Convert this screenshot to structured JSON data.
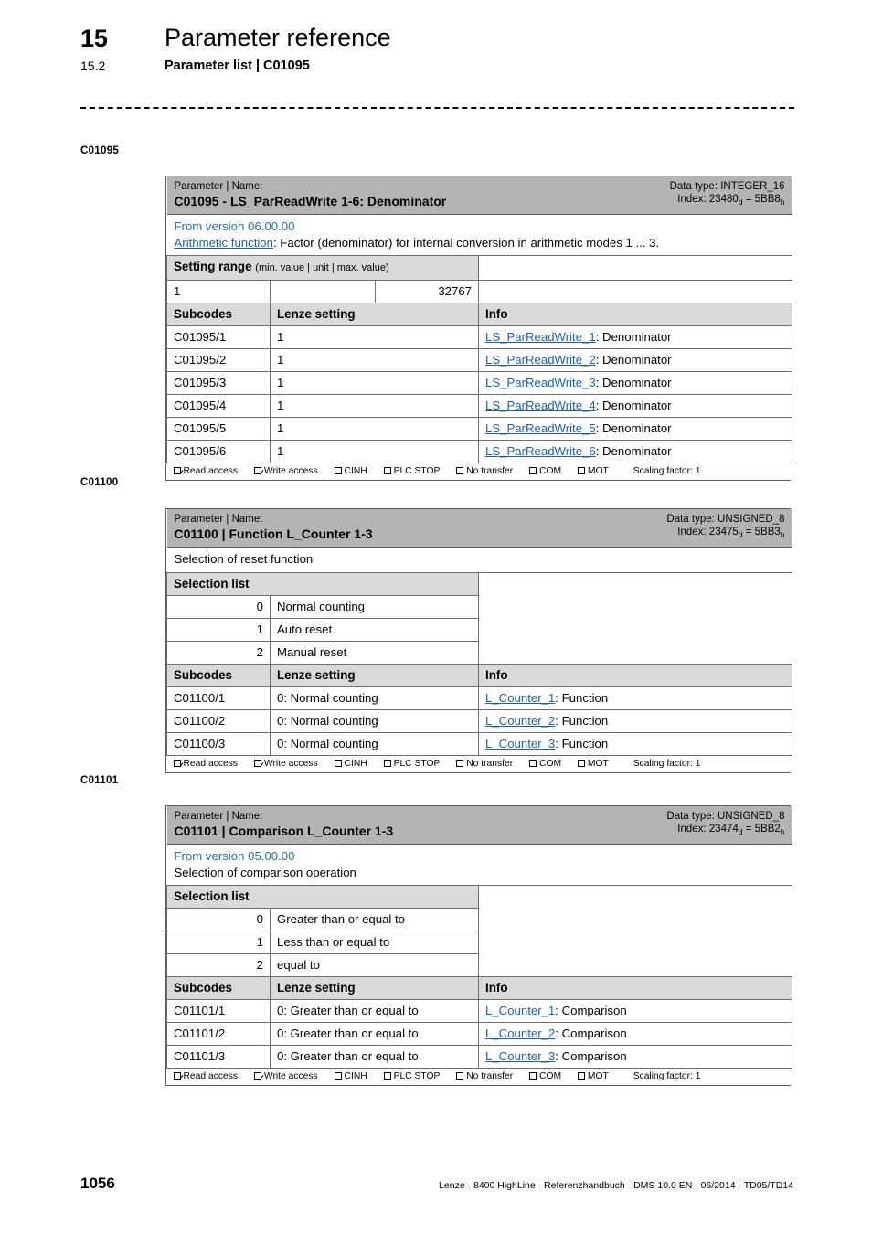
{
  "header": {
    "chapter_number": "15",
    "chapter_title": "Parameter reference",
    "section_number": "15.2",
    "section_title": "Parameter list | C01095"
  },
  "footer": {
    "page_number": "1056",
    "credit": "Lenze · 8400 HighLine · Referenzhandbuch · DMS 10.0 EN · 06/2014 · TD05/TD14"
  },
  "common": {
    "param_name_label": "Parameter | Name:",
    "subcodes_header": "Subcodes",
    "lenze_setting_header": "Lenze setting",
    "info_header": "Info",
    "selection_list_header": "Selection list",
    "access": {
      "read": "Read access",
      "write": "Write access",
      "cinh": "CINH",
      "plc_stop": "PLC STOP",
      "no_transfer": "No transfer",
      "com": "COM",
      "mot": "MOT",
      "scaling": "Scaling factor: 1"
    },
    "link_color": "#1f5fa9",
    "version_color": "#2b6ca3",
    "title_band_color": "#b4b4b4",
    "subheader_color": "#d9d9d9"
  },
  "blocks": [
    {
      "margin_label": "C01095",
      "name": "C01095 - LS_ParReadWrite 1-6: Denominator",
      "data_type": "Data type: INTEGER_16",
      "index_prefix": "Index: 23480",
      "index_sub1": "d",
      "index_mid": " = 5BB8",
      "index_sub2": "h",
      "version": "From version 06.00.00",
      "desc_link": "Arithmetic function",
      "desc_rest": ": Factor (denominator) for internal conversion in arithmetic modes 1 ... 3.",
      "setting_range_header": "Setting range",
      "setting_range_note": "(min. value | unit | max. value)",
      "setting_min": "1",
      "setting_unit": "",
      "setting_max": "32767",
      "rows": [
        {
          "subcode": "C01095/1",
          "setting": "1",
          "link": "LS_ParReadWrite_1",
          "info_rest": ": Denominator"
        },
        {
          "subcode": "C01095/2",
          "setting": "1",
          "link": "LS_ParReadWrite_2",
          "info_rest": ": Denominator"
        },
        {
          "subcode": "C01095/3",
          "setting": "1",
          "link": "LS_ParReadWrite_3",
          "info_rest": ": Denominator"
        },
        {
          "subcode": "C01095/4",
          "setting": "1",
          "link": "LS_ParReadWrite_4",
          "info_rest": ": Denominator"
        },
        {
          "subcode": "C01095/5",
          "setting": "1",
          "link": "LS_ParReadWrite_5",
          "info_rest": ": Denominator"
        },
        {
          "subcode": "C01095/6",
          "setting": "1",
          "link": "LS_ParReadWrite_6",
          "info_rest": ": Denominator"
        }
      ]
    },
    {
      "margin_label": "C01100",
      "name": "C01100 | Function L_Counter 1-3",
      "data_type": "Data type: UNSIGNED_8",
      "index_prefix": "Index: 23475",
      "index_sub1": "d",
      "index_mid": " = 5BB3",
      "index_sub2": "h",
      "version": "",
      "desc_plain": "Selection of reset function",
      "selection": [
        {
          "index": "0",
          "text": "Normal counting"
        },
        {
          "index": "1",
          "text": "Auto reset"
        },
        {
          "index": "2",
          "text": "Manual reset"
        }
      ],
      "rows": [
        {
          "subcode": "C01100/1",
          "setting": "0: Normal counting",
          "link": "L_Counter_1",
          "info_rest": ": Function"
        },
        {
          "subcode": "C01100/2",
          "setting": "0: Normal counting",
          "link": "L_Counter_2",
          "info_rest": ": Function"
        },
        {
          "subcode": "C01100/3",
          "setting": "0: Normal counting",
          "link": "L_Counter_3",
          "info_rest": ": Function"
        }
      ]
    },
    {
      "margin_label": "C01101",
      "name": "C01101 | Comparison L_Counter 1-3",
      "data_type": "Data type: UNSIGNED_8",
      "index_prefix": "Index: 23474",
      "index_sub1": "d",
      "index_mid": " = 5BB2",
      "index_sub2": "h",
      "version": "From version 05.00.00",
      "desc_plain": "Selection of comparison operation",
      "selection": [
        {
          "index": "0",
          "text": "Greater than or equal to"
        },
        {
          "index": "1",
          "text": "Less than or equal to"
        },
        {
          "index": "2",
          "text": "equal to"
        }
      ],
      "rows": [
        {
          "subcode": "C01101/1",
          "setting": "0: Greater than or equal to",
          "link": "L_Counter_1",
          "info_rest": ": Comparison"
        },
        {
          "subcode": "C01101/2",
          "setting": "0: Greater than or equal to",
          "link": "L_Counter_2",
          "info_rest": ": Comparison"
        },
        {
          "subcode": "C01101/3",
          "setting": "0: Greater than or equal to",
          "link": "L_Counter_3",
          "info_rest": ": Comparison"
        }
      ]
    }
  ]
}
